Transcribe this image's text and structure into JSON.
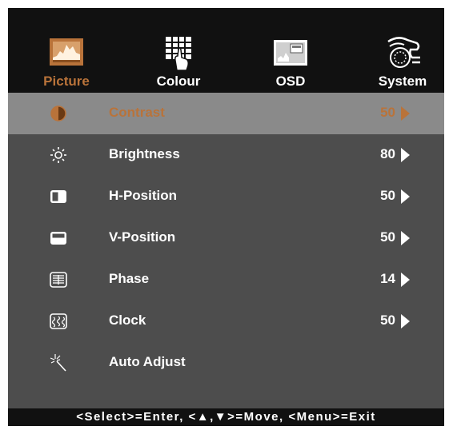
{
  "tabs": [
    {
      "label": "Picture",
      "icon": "picture-icon",
      "active": true
    },
    {
      "label": "Colour",
      "icon": "colour-grid-icon",
      "active": false
    },
    {
      "label": "OSD",
      "icon": "osd-screen-icon",
      "active": false
    },
    {
      "label": "System",
      "icon": "system-hand-icon",
      "active": false
    }
  ],
  "items": [
    {
      "label": "Contrast",
      "value": "50",
      "icon": "contrast-icon",
      "selected": true
    },
    {
      "label": "Brightness",
      "value": "80",
      "icon": "brightness-sun-icon",
      "selected": false
    },
    {
      "label": "H-Position",
      "value": "50",
      "icon": "h-position-icon",
      "selected": false
    },
    {
      "label": "V-Position",
      "value": "50",
      "icon": "v-position-icon",
      "selected": false
    },
    {
      "label": "Phase",
      "value": "14",
      "icon": "phase-icon",
      "selected": false
    },
    {
      "label": "Clock",
      "value": "50",
      "icon": "clock-icon",
      "selected": false
    },
    {
      "label": "Auto Adjust",
      "icon": "auto-adjust-wand-icon",
      "selected": false
    }
  ],
  "footer": {
    "hint": "<Select>=Enter, <▲,▼>=Move, <Menu>=Exit"
  },
  "colors": {
    "accent": "#b9733a",
    "menu_bg": "#4d4d4d",
    "selected_bg": "#8a8a8a",
    "frame_bg": "#111111",
    "text": "#ffffff"
  }
}
